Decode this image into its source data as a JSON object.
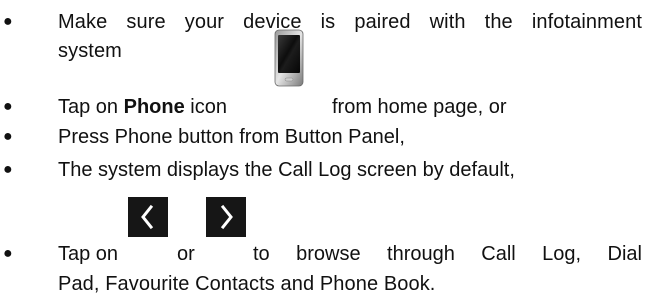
{
  "bullet_symbol": "●",
  "items": [
    {
      "line1": "Make sure your device is paired with the infotainment",
      "line2": "system"
    },
    {
      "prefix": "Tap on ",
      "bold": "Phone",
      "middle": " icon",
      "suffix": "from home page, or"
    },
    {
      "text": "Press Phone button from Button Panel,"
    },
    {
      "text": "The system displays the Call Log screen by default,"
    },
    {
      "prefix": "Tap on",
      "or": "or",
      "suffix": "to browse through Call Log, Dial",
      "line2": "Pad, Favourite Contacts and Phone Book."
    }
  ],
  "icons": {
    "phone": "phone-device-icon",
    "left": "chevron-left-icon",
    "right": "chevron-right-icon"
  }
}
